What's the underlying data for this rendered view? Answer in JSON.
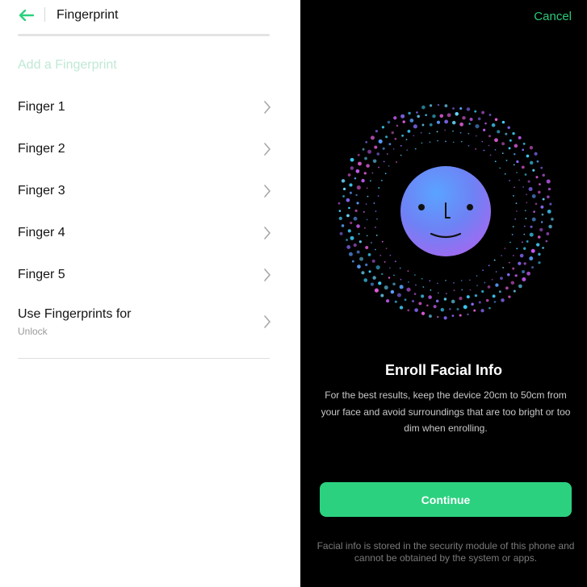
{
  "left": {
    "header": {
      "title": "Fingerprint",
      "back_icon": "arrow-left-icon"
    },
    "add_fingerprint_label": "Add a Fingerprint",
    "fingers": [
      {
        "label": "Finger 1"
      },
      {
        "label": "Finger 2"
      },
      {
        "label": "Finger 3"
      },
      {
        "label": "Finger 4"
      },
      {
        "label": "Finger 5"
      }
    ],
    "use_fingerprints": {
      "label": "Use Fingerprints for",
      "value": "Unlock"
    }
  },
  "right": {
    "cancel_label": "Cancel",
    "title": "Enroll Facial Info",
    "description": "For the best results, keep the device 20cm to 50cm from your face and avoid surroundings that are too bright or too dim when enrolling.",
    "continue_label": "Continue",
    "footer_note": "Facial info is stored in the security module of this phone and cannot be obtained by the system or apps."
  },
  "colors": {
    "accent": "#2bd17f",
    "accent_light": "#bfe9d4",
    "dark_bg": "#000000"
  }
}
